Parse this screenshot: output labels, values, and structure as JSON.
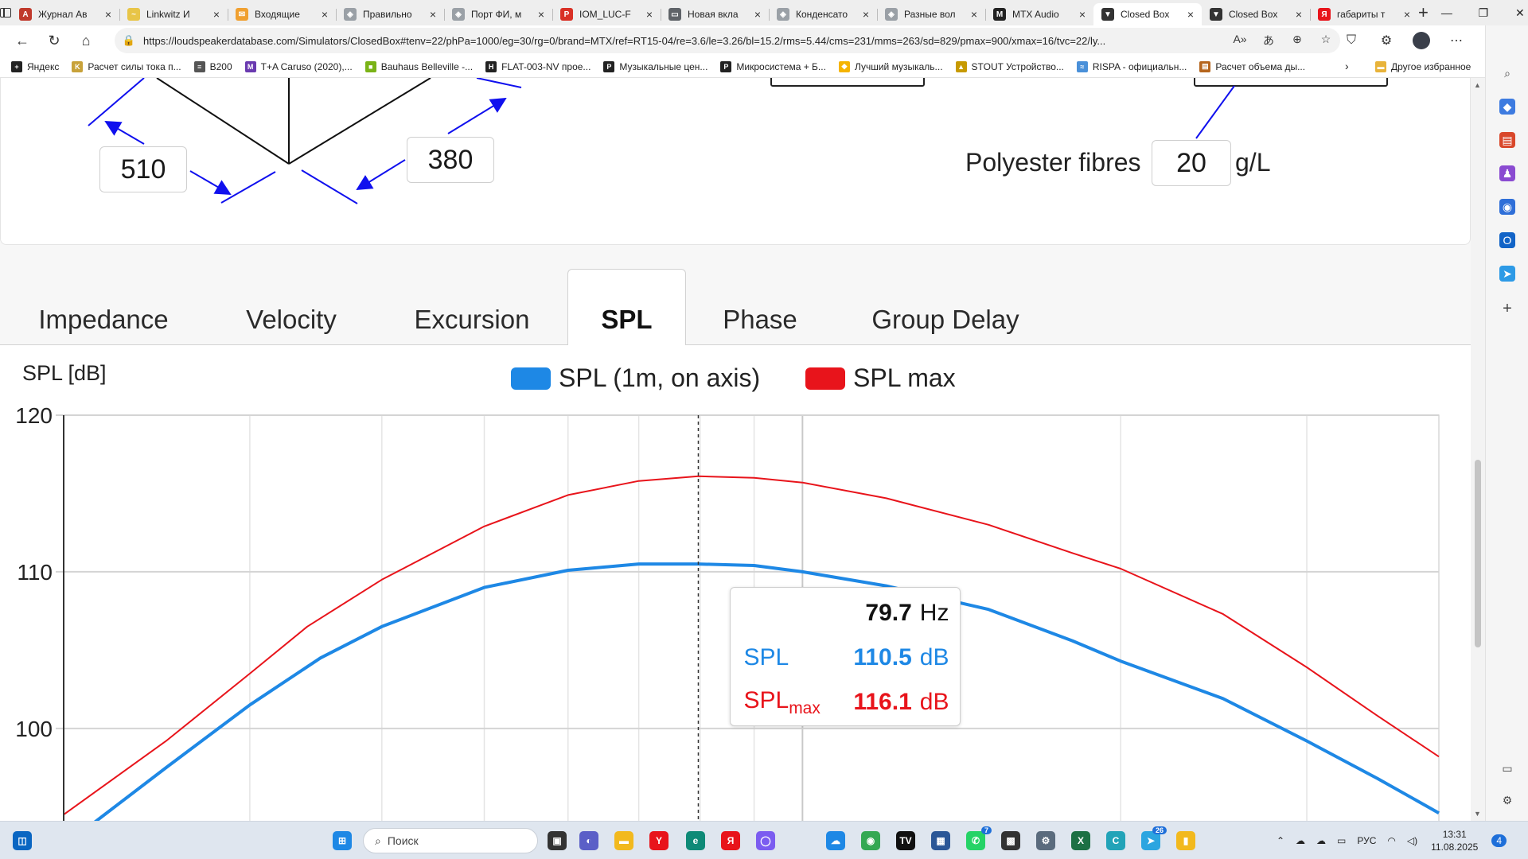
{
  "browser": {
    "tabs": [
      {
        "title": "Журнал Ав",
        "color": "#c0392b",
        "glyph": "A"
      },
      {
        "title": "Linkwitz И",
        "color": "#e8c547",
        "glyph": "~"
      },
      {
        "title": "Входящие",
        "color": "#f0a030",
        "glyph": "✉"
      },
      {
        "title": "Правильно",
        "color": "#9aa0a6",
        "glyph": "◈"
      },
      {
        "title": "Порт ФИ, м",
        "color": "#9aa0a6",
        "glyph": "◈"
      },
      {
        "title": "IOM_LUC-F",
        "color": "#d93025",
        "glyph": "P"
      },
      {
        "title": "Новая вкла",
        "color": "#5f6368",
        "glyph": "▭"
      },
      {
        "title": "Конденсато",
        "color": "#9aa0a6",
        "glyph": "◈"
      },
      {
        "title": "Разные вол",
        "color": "#9aa0a6",
        "glyph": "◈"
      },
      {
        "title": "MTX Audio",
        "color": "#222222",
        "glyph": "M"
      },
      {
        "title": "Closed Box",
        "color": "#333333",
        "glyph": "▼",
        "active": true
      },
      {
        "title": "Closed Box",
        "color": "#333333",
        "glyph": "▼"
      },
      {
        "title": "габариты т",
        "color": "#e8141b",
        "glyph": "Я"
      }
    ],
    "url": "https://loudspeakerdatabase.com/Simulators/ClosedBox#tenv=22/phPa=1000/eg=30/rg=0/brand=MTX/ref=RT15-04/re=3.6/le=3.26/bl=15.2/rms=5.44/cms=231/mms=263/sd=829/pmax=900/xmax=16/tvc=22/ly...",
    "bookmarks": [
      {
        "label": "Яндекс",
        "color": "#222222",
        "glyph": "+"
      },
      {
        "label": "Расчет силы тока п...",
        "color": "#c8a23a",
        "glyph": "K"
      },
      {
        "label": "B200",
        "color": "#555555",
        "glyph": "≡"
      },
      {
        "label": "T+A Caruso (2020),...",
        "color": "#6a3ab0",
        "glyph": "M"
      },
      {
        "label": "Bauhaus Belleville -...",
        "color": "#7ab317",
        "glyph": "■"
      },
      {
        "label": "FLAT-003-NV прое...",
        "color": "#222222",
        "glyph": "H"
      },
      {
        "label": "Музыкальные цен...",
        "color": "#222222",
        "glyph": "P"
      },
      {
        "label": "Микросистема + Б...",
        "color": "#222222",
        "glyph": "P"
      },
      {
        "label": "Лучший музыкаль...",
        "color": "#f5b400",
        "glyph": "◆"
      },
      {
        "label": "STOUT Устройство...",
        "color": "#c79a00",
        "glyph": "▲"
      },
      {
        "label": "RISPA - официальн...",
        "color": "#4a90d9",
        "glyph": "≈"
      },
      {
        "label": "Расчет объема ды...",
        "color": "#b5651d",
        "glyph": "▤"
      }
    ],
    "other_bookmarks": "Другое избранное"
  },
  "form": {
    "dim_left": "510",
    "dim_right": "380",
    "fill_material": "Polyester fibres",
    "fill_density": "20",
    "fill_unit": "g/L"
  },
  "result_tabs": [
    {
      "label": "Impedance",
      "active": false
    },
    {
      "label": "Velocity",
      "active": false
    },
    {
      "label": "Excursion",
      "active": false
    },
    {
      "label": "SPL",
      "active": true
    },
    {
      "label": "Phase",
      "active": false
    },
    {
      "label": "Group Delay",
      "active": false
    }
  ],
  "chart_data": {
    "type": "line",
    "ylabel": "SPL [dB]",
    "y_ticks": [
      100,
      110,
      120
    ],
    "ylim": [
      94,
      120
    ],
    "x_scale": "log",
    "xlim": [
      20,
      400
    ],
    "grid": true,
    "legend_position": "top",
    "cursor_x": 79.7,
    "series": [
      {
        "name": "SPL (1m, on axis)",
        "color": "#1e88e5",
        "x": [
          20,
          25,
          30,
          35,
          40,
          50,
          60,
          70,
          79.7,
          90,
          100,
          120,
          150,
          180,
          200,
          250,
          300,
          350,
          400
        ],
        "y": [
          92.5,
          97.5,
          101.5,
          104.5,
          106.5,
          109.0,
          110.1,
          110.5,
          110.5,
          110.4,
          110.0,
          109.1,
          107.6,
          105.6,
          104.3,
          101.9,
          99.2,
          96.8,
          94.6
        ]
      },
      {
        "name": "SPL max",
        "color": "#e8141b",
        "x": [
          20,
          25,
          30,
          34,
          40,
          50,
          60,
          70,
          79.7,
          90,
          100,
          120,
          150,
          180,
          200,
          250,
          300,
          350,
          400
        ],
        "y": [
          94.5,
          99.2,
          103.5,
          106.5,
          109.5,
          112.9,
          114.9,
          115.8,
          116.1,
          116.0,
          115.7,
          114.7,
          113.0,
          111.2,
          110.2,
          107.3,
          103.9,
          100.8,
          98.2
        ]
      }
    ]
  },
  "tooltip": {
    "freq_value": "79.7",
    "freq_unit": "Hz",
    "spl_label": "SPL",
    "spl_value": "110.5",
    "spl_unit": "dB",
    "splmax_label": "SPL",
    "splmax_sub": "max",
    "splmax_value": "116.1",
    "splmax_unit": "dB"
  },
  "taskbar": {
    "search_placeholder": "Поиск",
    "language": "РУС",
    "time": "13:31",
    "date": "11.08.2025",
    "notification_count": "4",
    "whatsapp_badge": "7",
    "telegram_badge": "26"
  }
}
